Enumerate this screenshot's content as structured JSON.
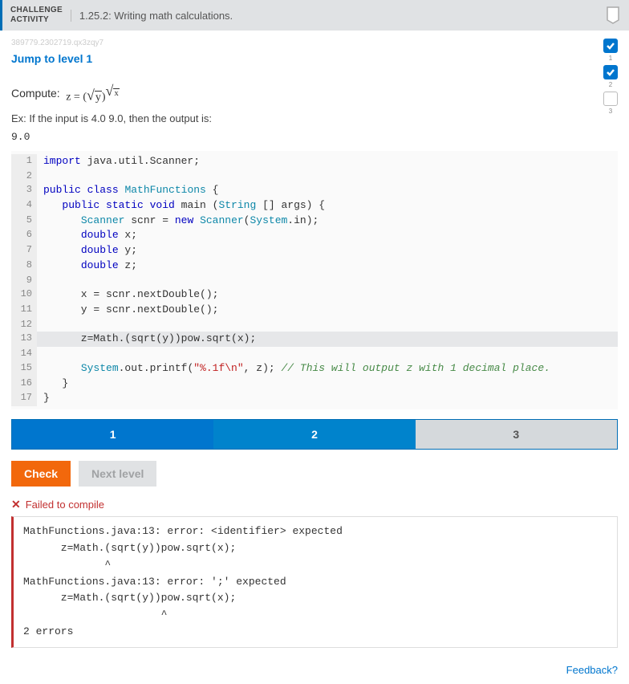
{
  "header": {
    "label_line1": "CHALLENGE",
    "label_line2": "ACTIVITY",
    "title": "1.25.2: Writing math calculations."
  },
  "watermark": "389779.2302719.qx3zqy7",
  "jump_link": "Jump to level 1",
  "progress": [
    {
      "state": "done",
      "num": "1"
    },
    {
      "state": "done",
      "num": "2"
    },
    {
      "state": "pending",
      "num": "3"
    }
  ],
  "compute_prefix": "Compute:",
  "example": "Ex: If the input is 4.0 9.0, then the output is:",
  "example_output": "9.0",
  "code_lines": [
    {
      "n": "1",
      "html": "<span class='kw'>import</span> java.util.Scanner;"
    },
    {
      "n": "2",
      "html": ""
    },
    {
      "n": "3",
      "html": "<span class='kw'>public class</span> <span class='type'>MathFunctions</span> {"
    },
    {
      "n": "4",
      "html": "   <span class='kw'>public static void</span> main (<span class='type'>String</span> [] args) {"
    },
    {
      "n": "5",
      "html": "      <span class='type'>Scanner</span> scnr = <span class='kw'>new</span> <span class='type'>Scanner</span>(<span class='type'>System</span>.in);"
    },
    {
      "n": "6",
      "html": "      <span class='kw'>double</span> x;"
    },
    {
      "n": "7",
      "html": "      <span class='kw'>double</span> y;"
    },
    {
      "n": "8",
      "html": "      <span class='kw'>double</span> z;"
    },
    {
      "n": "9",
      "html": ""
    },
    {
      "n": "10",
      "html": "      x = scnr.nextDouble();"
    },
    {
      "n": "11",
      "html": "      y = scnr.nextDouble();"
    },
    {
      "n": "12",
      "html": ""
    },
    {
      "n": "13",
      "html": "      z=Math.(sqrt(y))pow.sqrt(x);",
      "hl": true
    },
    {
      "n": "14",
      "html": ""
    },
    {
      "n": "15",
      "html": "      <span class='type'>System</span>.out.printf(<span class='str'>\"%.1f\\n\"</span>, z); <span class='cmt'>// This will output z with 1 decimal place.</span>"
    },
    {
      "n": "16",
      "html": "   }"
    },
    {
      "n": "17",
      "html": "}"
    }
  ],
  "tabs": [
    {
      "label": "1",
      "state": "done"
    },
    {
      "label": "2",
      "state": "active"
    },
    {
      "label": "3",
      "state": "pending"
    }
  ],
  "buttons": {
    "check": "Check",
    "next": "Next level"
  },
  "fail_label": "Failed to compile",
  "error_output": "MathFunctions.java:13: error: <identifier> expected\n      z=Math.(sqrt(y))pow.sqrt(x);\n             ^\nMathFunctions.java:13: error: ';' expected\n      z=Math.(sqrt(y))pow.sqrt(x);\n                      ^\n2 errors",
  "feedback": "Feedback?"
}
